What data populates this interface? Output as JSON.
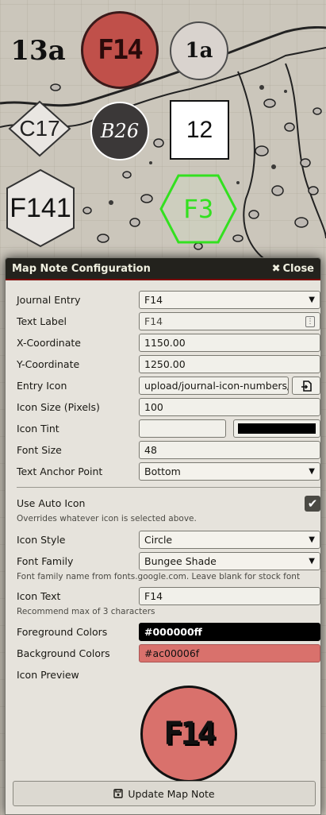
{
  "map": {
    "tokens": {
      "t13a": "13a",
      "f14": "F14",
      "t1a": "1a",
      "c17": "C17",
      "b26": "B26",
      "t12": "12",
      "f141": "F141",
      "f3": "F3"
    }
  },
  "dialog": {
    "title": "Map Note Configuration",
    "close_label": "Close",
    "close_icon": "times-icon",
    "fields": {
      "journal_entry": {
        "label": "Journal Entry",
        "value": "F14"
      },
      "text_label": {
        "label": "Text Label",
        "value": "F14"
      },
      "x_coordinate": {
        "label": "X-Coordinate",
        "value": "1150.00"
      },
      "y_coordinate": {
        "label": "Y-Coordinate",
        "value": "1250.00"
      },
      "entry_icon": {
        "label": "Entry Icon",
        "value": "upload/journal-icon-numbers/"
      },
      "icon_size": {
        "label": "Icon Size (Pixels)",
        "value": "100"
      },
      "icon_tint": {
        "label": "Icon Tint",
        "value": "",
        "color": "#000000"
      },
      "font_size": {
        "label": "Font Size",
        "value": "48"
      },
      "text_anchor": {
        "label": "Text Anchor Point",
        "value": "Bottom"
      },
      "use_auto_icon": {
        "label": "Use Auto Icon",
        "checked": true,
        "note": "Overrides whatever icon is selected above."
      },
      "icon_style": {
        "label": "Icon Style",
        "value": "Circle"
      },
      "font_family": {
        "label": "Font Family",
        "value": "Bungee Shade",
        "note": "Font family name from fonts.google.com. Leave blank for stock font"
      },
      "icon_text": {
        "label": "Icon Text",
        "value": "F14",
        "note": "Recommend max of 3 characters"
      },
      "foreground_colors": {
        "label": "Foreground Colors",
        "value": "#000000ff",
        "color": "#000000"
      },
      "background_colors": {
        "label": "Background Colors",
        "value": "#ac00006f",
        "color": "#d9716c"
      },
      "icon_preview": {
        "label": "Icon Preview",
        "text": "F14"
      }
    },
    "update_button": "Update Map Note"
  }
}
